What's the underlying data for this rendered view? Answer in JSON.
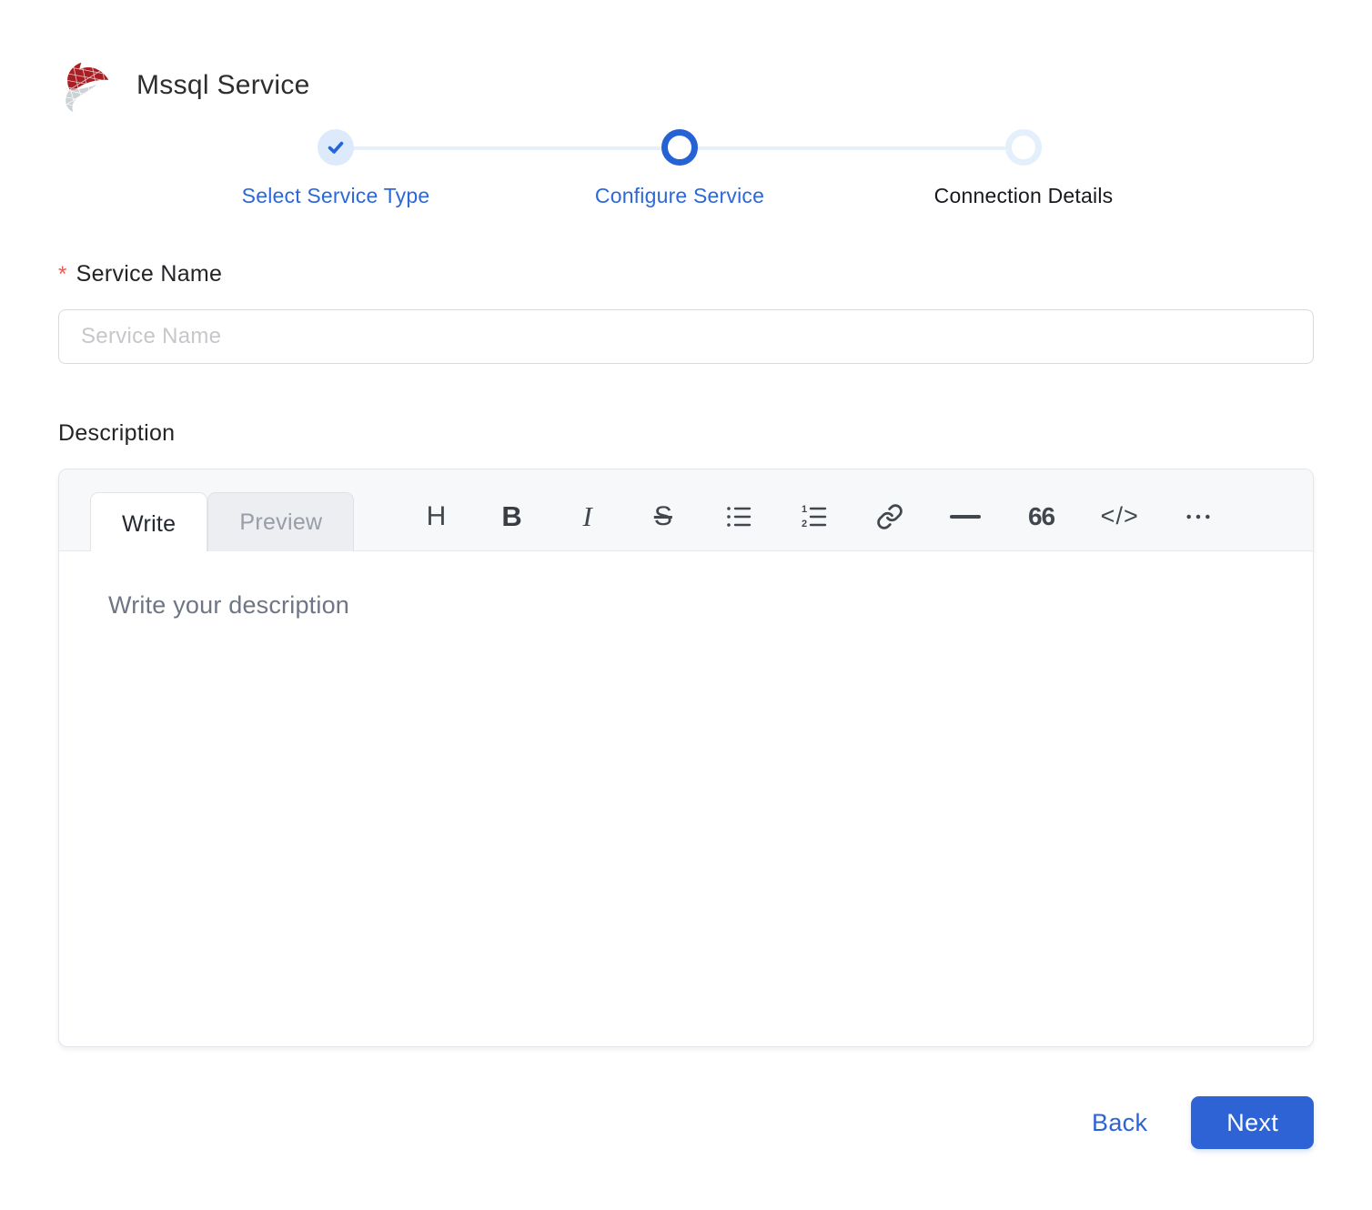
{
  "header": {
    "title": "Mssql Service"
  },
  "stepper": {
    "steps": [
      {
        "label": "Select Service Type",
        "state": "completed"
      },
      {
        "label": "Configure Service",
        "state": "current"
      },
      {
        "label": "Connection Details",
        "state": "upcoming"
      }
    ]
  },
  "form": {
    "service_name": {
      "required_marker": "*",
      "label": "Service Name",
      "placeholder": "Service Name",
      "value": ""
    },
    "description": {
      "label": "Description",
      "editor": {
        "tabs": [
          {
            "label": "Write",
            "active": true
          },
          {
            "label": "Preview",
            "active": false
          }
        ],
        "toolbar": [
          {
            "name": "heading",
            "glyph": "H"
          },
          {
            "name": "bold",
            "glyph": "B"
          },
          {
            "name": "italic",
            "glyph": "I"
          },
          {
            "name": "strikethrough",
            "glyph": "S"
          },
          {
            "name": "unordered-list"
          },
          {
            "name": "ordered-list"
          },
          {
            "name": "link"
          },
          {
            "name": "horizontal-rule"
          },
          {
            "name": "quote",
            "glyph": "66"
          },
          {
            "name": "code",
            "glyph": "</>"
          },
          {
            "name": "more"
          }
        ],
        "placeholder": "Write your description",
        "value": ""
      }
    }
  },
  "footer": {
    "back_label": "Back",
    "next_label": "Next"
  },
  "colors": {
    "accent_blue": "#2d63d5",
    "step_active_blue": "#2563d4",
    "step_inactive_blue": "#e4effc",
    "required_red": "#ee5951",
    "logo_red": "#a81e22",
    "logo_gray": "#ccd2d6"
  }
}
